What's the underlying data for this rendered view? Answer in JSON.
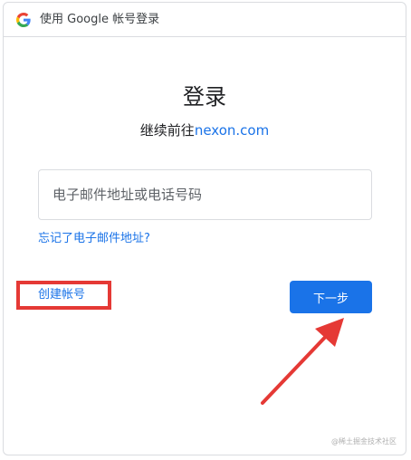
{
  "header": {
    "title": "使用 Google 帐号登录",
    "logo_icon": "google-g-icon"
  },
  "main": {
    "title": "登录",
    "subtitle_prefix": "继续前往",
    "subtitle_domain": "nexon.com"
  },
  "form": {
    "email_placeholder": "电子邮件地址或电话号码",
    "email_value": "",
    "forgot_label": "忘记了电子邮件地址?",
    "create_account_label": "创建帐号",
    "next_label": "下一步"
  },
  "annotations": {
    "highlight_color": "#e53935",
    "arrow_icon": "red-arrow-icon"
  },
  "watermark": "@稀土掘金技术社区",
  "colors": {
    "accent": "#1a73e8",
    "border": "#dadce0",
    "text": "#202124"
  }
}
